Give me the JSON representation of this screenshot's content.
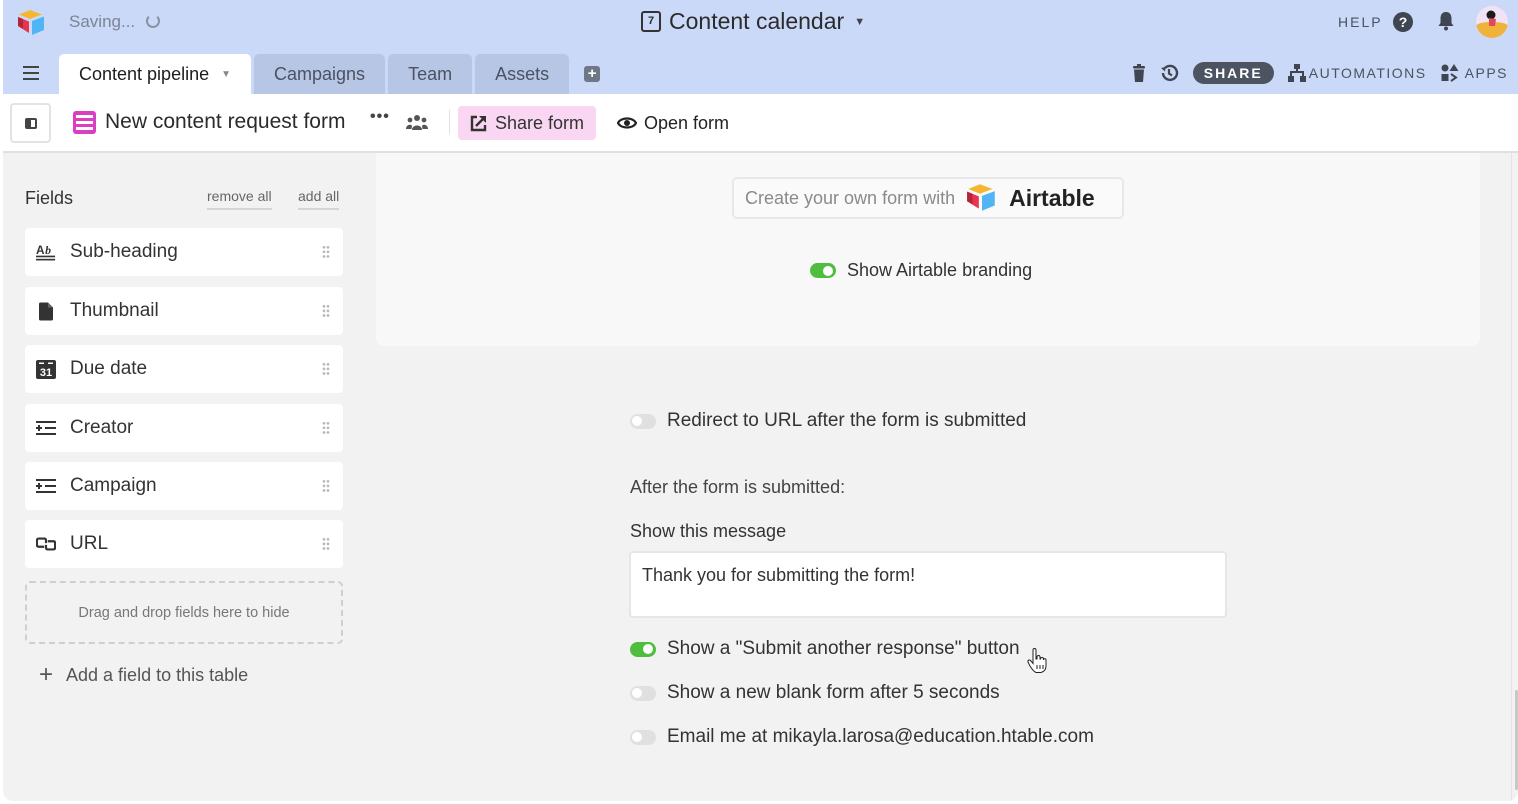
{
  "topbar": {
    "saving_text": "Saving...",
    "base_title": "Content calendar",
    "help_label": "HELP",
    "help_icon_glyph": "?",
    "calendar_icon_day": "7"
  },
  "tabs": [
    {
      "label": "Content pipeline",
      "active": true
    },
    {
      "label": "Campaigns",
      "active": false
    },
    {
      "label": "Team",
      "active": false
    },
    {
      "label": "Assets",
      "active": false
    }
  ],
  "toolbar": {
    "add_tab_glyph": "+",
    "share_label": "SHARE",
    "automations_label": "AUTOMATIONS",
    "apps_label": "APPS"
  },
  "viewbar": {
    "view_name": "New content request form",
    "more_glyph": "•••",
    "share_form_label": "Share form",
    "open_form_label": "Open form"
  },
  "fields_panel": {
    "title": "Fields",
    "remove_all_label": "remove all",
    "add_all_label": "add all",
    "fields": [
      {
        "name": "Sub-heading",
        "icon": "long-text-icon"
      },
      {
        "name": "Thumbnail",
        "icon": "attachment-icon"
      },
      {
        "name": "Due date",
        "icon": "date-icon"
      },
      {
        "name": "Creator",
        "icon": "single-select-icon"
      },
      {
        "name": "Campaign",
        "icon": "single-select-icon"
      },
      {
        "name": "URL",
        "icon": "link-icon"
      }
    ],
    "drop_zone_text": "Drag and drop fields here to hide",
    "add_field_label": "Add a field to this table",
    "date_icon_day": "31"
  },
  "branding": {
    "create_text": "Create your own form with",
    "brand_name": "Airtable",
    "show_branding_label": "Show Airtable branding",
    "show_branding_on": true
  },
  "submission": {
    "redirect_label": "Redirect to URL after the form is submitted",
    "redirect_on": false,
    "after_label": "After the form is submitted:",
    "message_label": "Show this message",
    "message_value": "Thank you for submitting the form!",
    "options": [
      {
        "label": "Show a \"Submit another response\" button",
        "on": true
      },
      {
        "label": "Show a new blank form after 5 seconds",
        "on": false
      },
      {
        "label": "Email me at mikayla.larosa@education.htable.com",
        "on": false
      }
    ]
  },
  "colors": {
    "topbar_bg": "#cbd9f8",
    "share_form_bg": "#f9d6f1",
    "form_icon": "#d93ec3",
    "toggle_on": "#4fbe3f",
    "toggle_off": "#e0e0e0"
  }
}
